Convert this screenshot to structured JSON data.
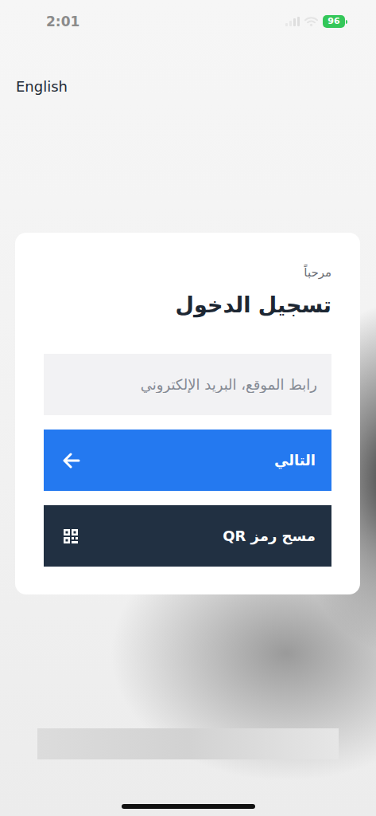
{
  "status_bar": {
    "time": "2:01",
    "battery": "96"
  },
  "language_link": "English",
  "login_card": {
    "greeting": "مرحباً",
    "title": "تسجيل الدخول",
    "field": {
      "placeholder": "رابط الموقع، البريد الإلكتروني"
    },
    "buttons": [
      {
        "label": "التالي",
        "kind": "next"
      },
      {
        "label": "مسح رمز QR",
        "kind": "qr"
      }
    ]
  }
}
